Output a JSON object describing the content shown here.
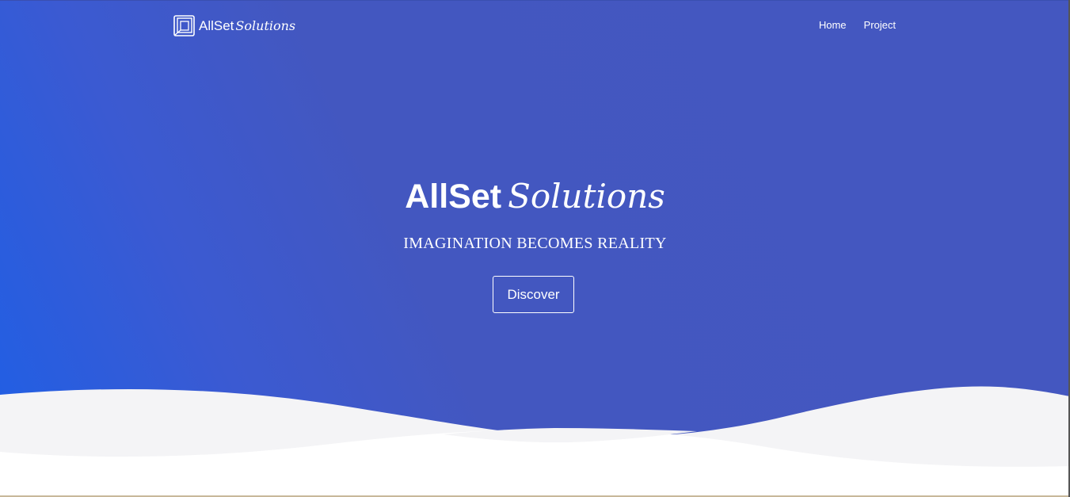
{
  "navbar": {
    "brand": {
      "logo_icon": "book-frame-icon",
      "name": "AllSet",
      "name_script": "Solutions"
    },
    "links": [
      {
        "label": "Home"
      },
      {
        "label": "Project"
      }
    ]
  },
  "hero": {
    "title": "AllSet",
    "title_script": "Solutions",
    "tagline": "IMAGINATION BECOMES REALITY",
    "cta_label": "Discover"
  },
  "colors": {
    "hero_primary": "#4457c0",
    "hero_gradient_start": "#1e5fe6",
    "wave_light": "#f4f4f6",
    "wave_white": "#ffffff",
    "text": "#ffffff"
  }
}
